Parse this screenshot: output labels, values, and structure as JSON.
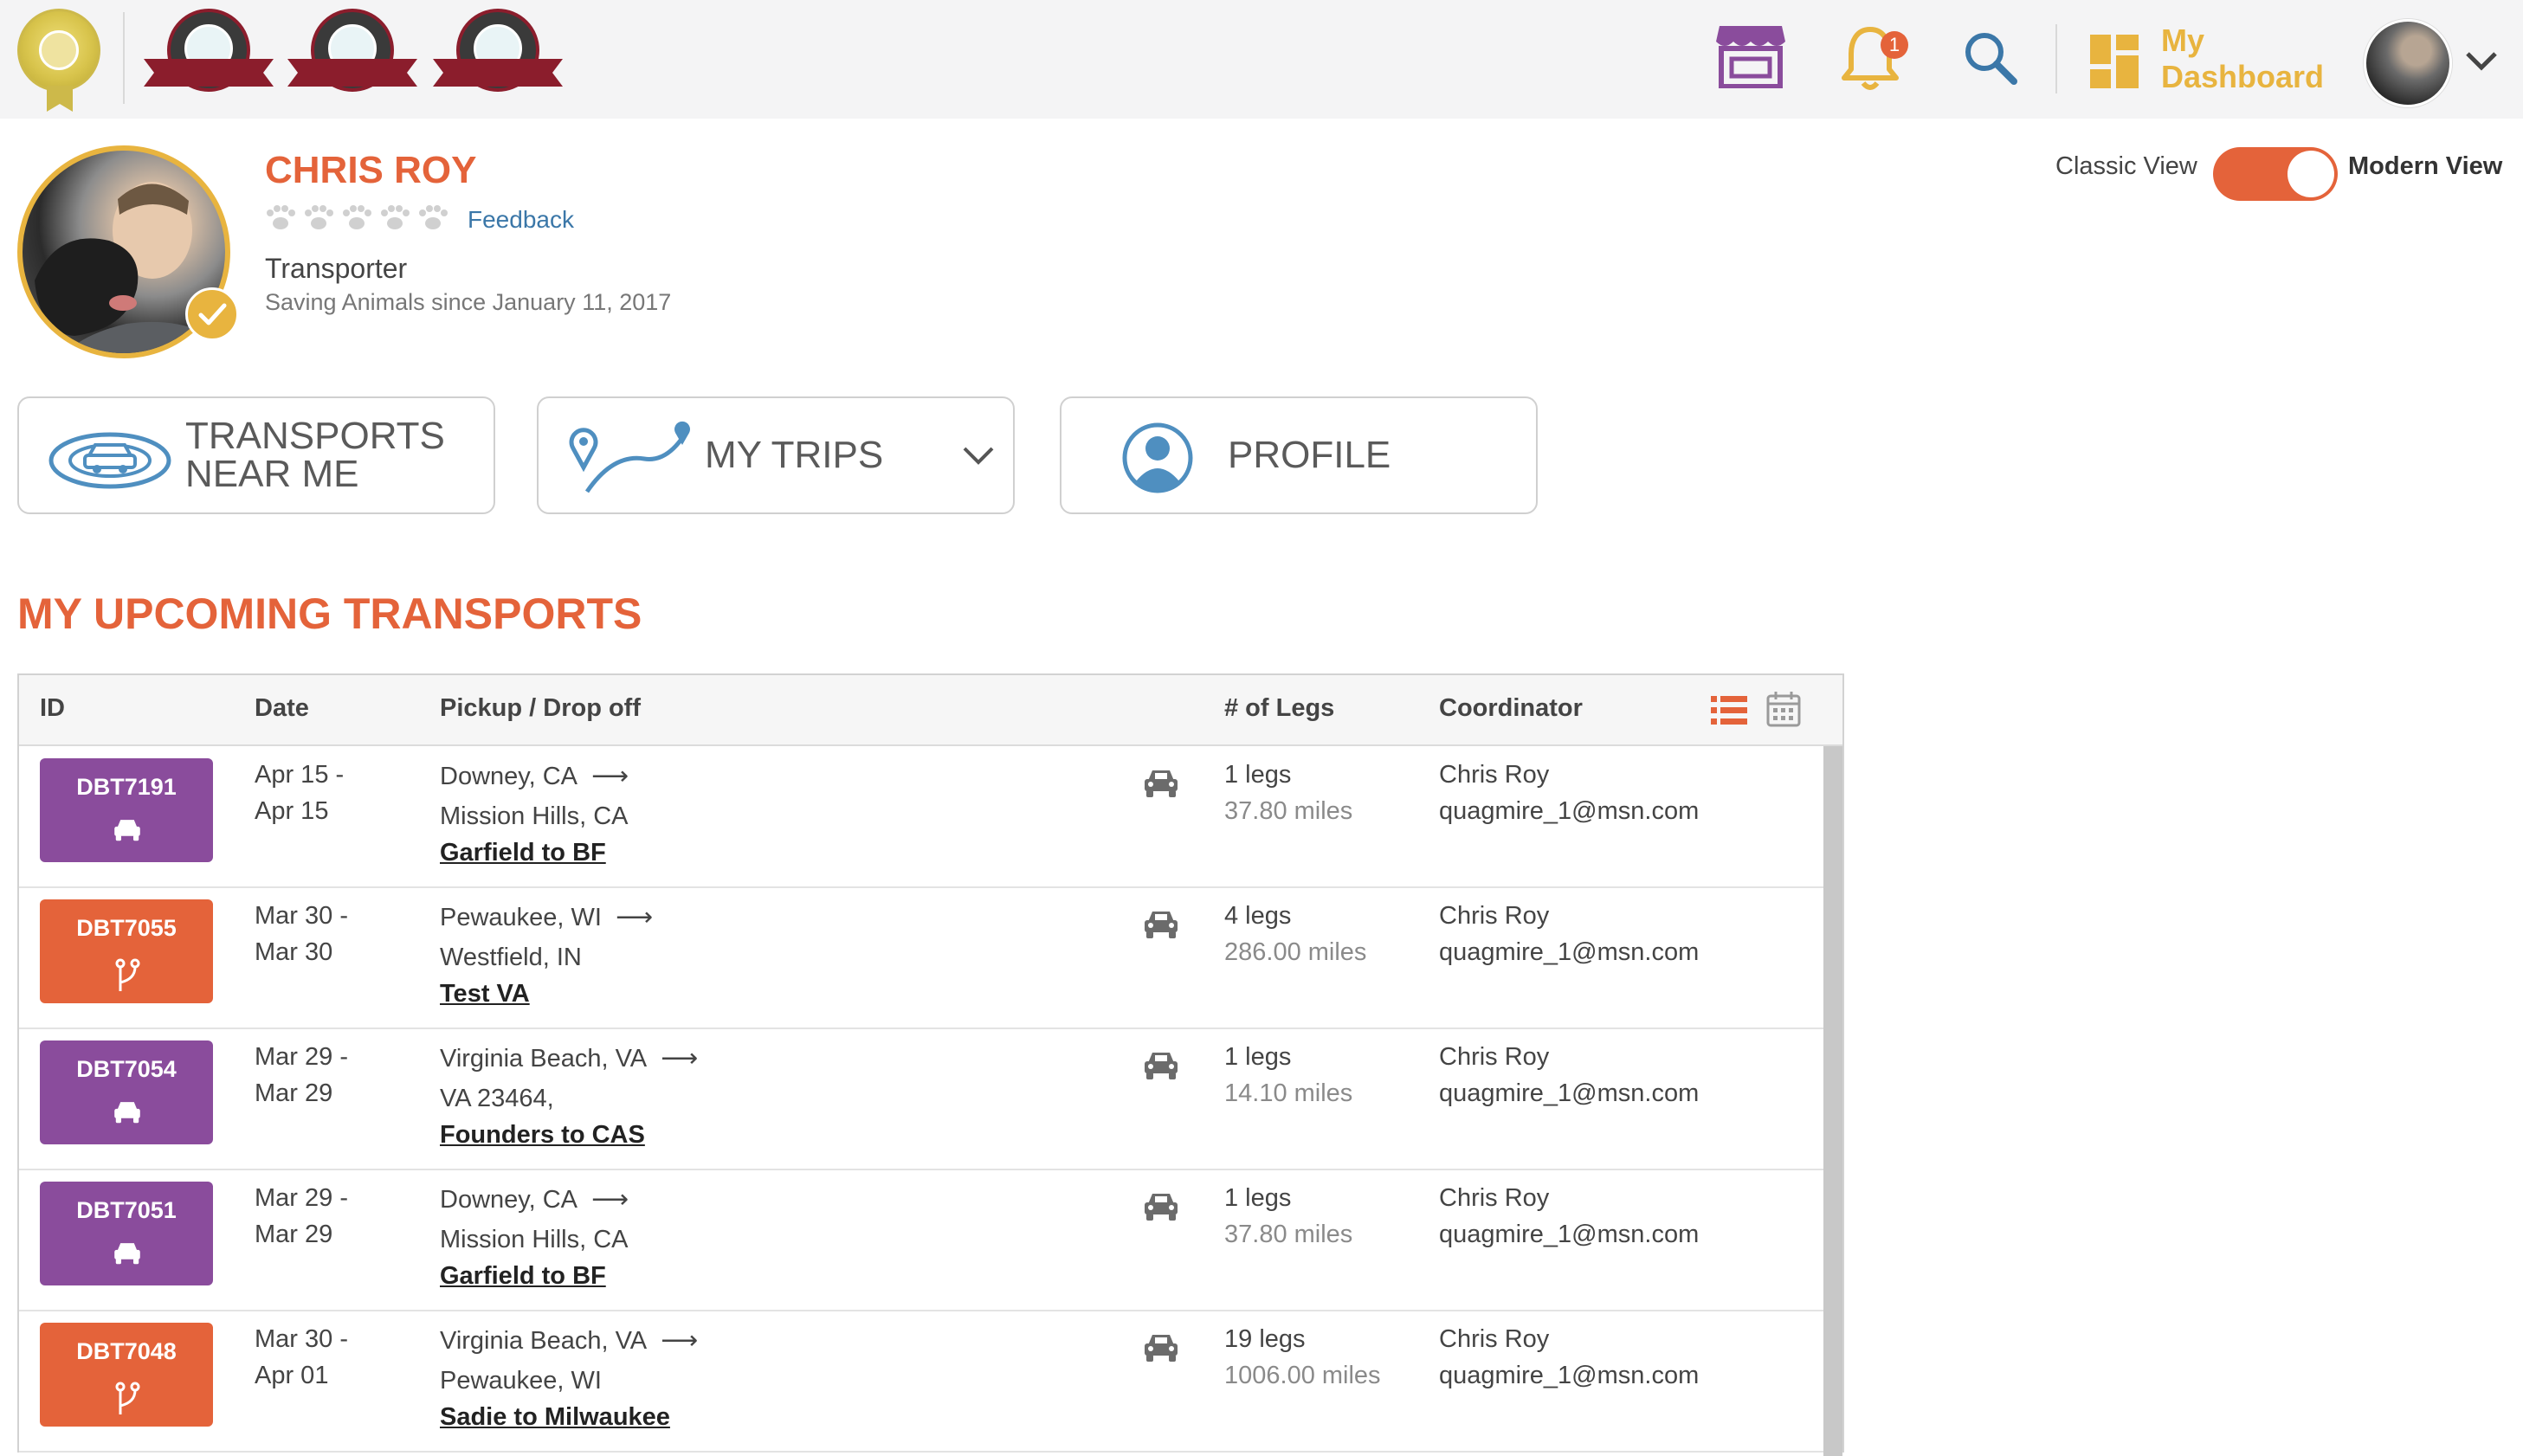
{
  "header": {
    "badges": [
      "gold-seal-icon",
      "certified-badge-1",
      "certified-badge-2",
      "certified-badge-3"
    ],
    "notification_count": "1",
    "dashboard_label_line1": "My",
    "dashboard_label_line2": "Dashboard"
  },
  "profile": {
    "name": "CHRIS ROY",
    "feedback_label": "Feedback",
    "role": "Transporter",
    "since": "Saving Animals since January 11, 2017"
  },
  "view_toggle": {
    "classic_label": "Classic View",
    "modern_label": "Modern View",
    "modern_active": true
  },
  "actions": {
    "transports_line1": "TRANSPORTS",
    "transports_line2": "NEAR ME",
    "my_trips": "MY TRIPS",
    "profile": "PROFILE"
  },
  "section": {
    "title": "MY UPCOMING TRANSPORTS"
  },
  "table": {
    "headers": {
      "id": "ID",
      "date": "Date",
      "pickup": "Pickup / Drop off",
      "legs": "# of Legs",
      "coordinator": "Coordinator"
    },
    "rows": [
      {
        "id": "DBT7191",
        "color": "purple",
        "icon": "car-icon",
        "date1": "Apr 15 -",
        "date2": "Apr 15",
        "from": "Downey, CA",
        "to": "Mission Hills, CA",
        "name": "Garfield to BF",
        "legs": "1 legs",
        "miles": "37.80 miles",
        "coord_name": "Chris Roy",
        "coord_email": "quagmire_1@msn.com"
      },
      {
        "id": "DBT7055",
        "color": "orange",
        "icon": "branch-icon",
        "date1": "Mar 30 -",
        "date2": "Mar 30",
        "from": "Pewaukee, WI",
        "to": "Westfield, IN",
        "name": "Test VA",
        "legs": "4 legs",
        "miles": "286.00 miles",
        "coord_name": "Chris Roy",
        "coord_email": "quagmire_1@msn.com"
      },
      {
        "id": "DBT7054",
        "color": "purple",
        "icon": "car-icon",
        "date1": "Mar 29 -",
        "date2": "Mar 29",
        "from": "Virginia Beach, VA",
        "to": "VA 23464,",
        "name": "Founders to CAS",
        "legs": "1 legs",
        "miles": "14.10 miles",
        "coord_name": "Chris Roy",
        "coord_email": "quagmire_1@msn.com"
      },
      {
        "id": "DBT7051",
        "color": "purple",
        "icon": "car-icon",
        "date1": "Mar 29 -",
        "date2": "Mar 29",
        "from": "Downey, CA",
        "to": "Mission Hills, CA",
        "name": "Garfield to BF",
        "legs": "1 legs",
        "miles": "37.80 miles",
        "coord_name": "Chris Roy",
        "coord_email": "quagmire_1@msn.com"
      },
      {
        "id": "DBT7048",
        "color": "orange",
        "icon": "branch-icon",
        "date1": "Mar 30 -",
        "date2": "Apr 01",
        "from": "Virginia Beach, VA",
        "to": "Pewaukee, WI",
        "name": "Sadie to Milwaukee",
        "legs": "19 legs",
        "miles": "1006.00 miles",
        "coord_name": "Chris Roy",
        "coord_email": "quagmire_1@msn.com"
      }
    ]
  },
  "colors": {
    "accent": "#e4633a",
    "purple": "#8a4c9c",
    "gold": "#e8b43f",
    "blue": "#3b77a8"
  }
}
